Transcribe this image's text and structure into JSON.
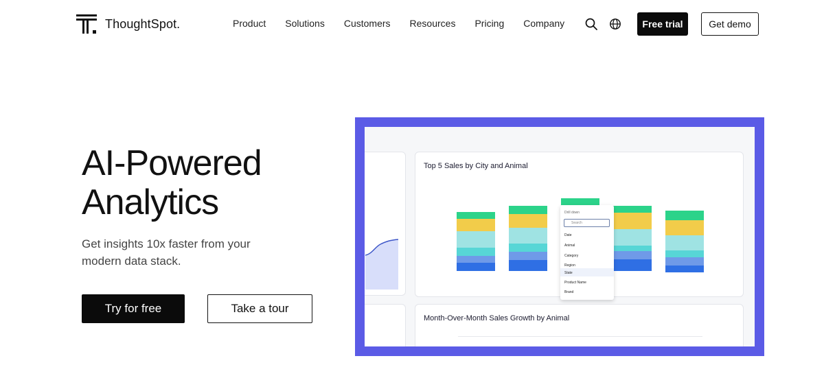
{
  "brand": {
    "name": "ThoughtSpot."
  },
  "nav": {
    "links": [
      "Product",
      "Solutions",
      "Customers",
      "Resources",
      "Pricing",
      "Company"
    ],
    "free_trial": "Free trial",
    "get_demo": "Get demo",
    "icons": [
      "search-icon",
      "globe-icon"
    ]
  },
  "hero": {
    "title_line1": "AI-Powered",
    "title_line2": "Analytics",
    "subtitle": "Get insights 10x faster from your modern data stack.",
    "try_free": "Try for free",
    "take_tour": "Take a tour"
  },
  "preview": {
    "frame_color": "#5b5be6",
    "card1_title": "Top 5 Sales by City and Animal",
    "card2_title": "Month-Over-Month Sales Growth by Animal",
    "dropdown": {
      "header": "Drill down",
      "search_placeholder": "Search",
      "items": [
        "Date",
        "Animal",
        "Category",
        "Region",
        "State",
        "Product Name",
        "Brand"
      ],
      "selected": "State"
    },
    "bar_colors": [
      "#2f6fe4",
      "#6f9ae8",
      "#57d6d6",
      "#9fe3e3",
      "#f2cc4a",
      "#2cd38a"
    ]
  }
}
